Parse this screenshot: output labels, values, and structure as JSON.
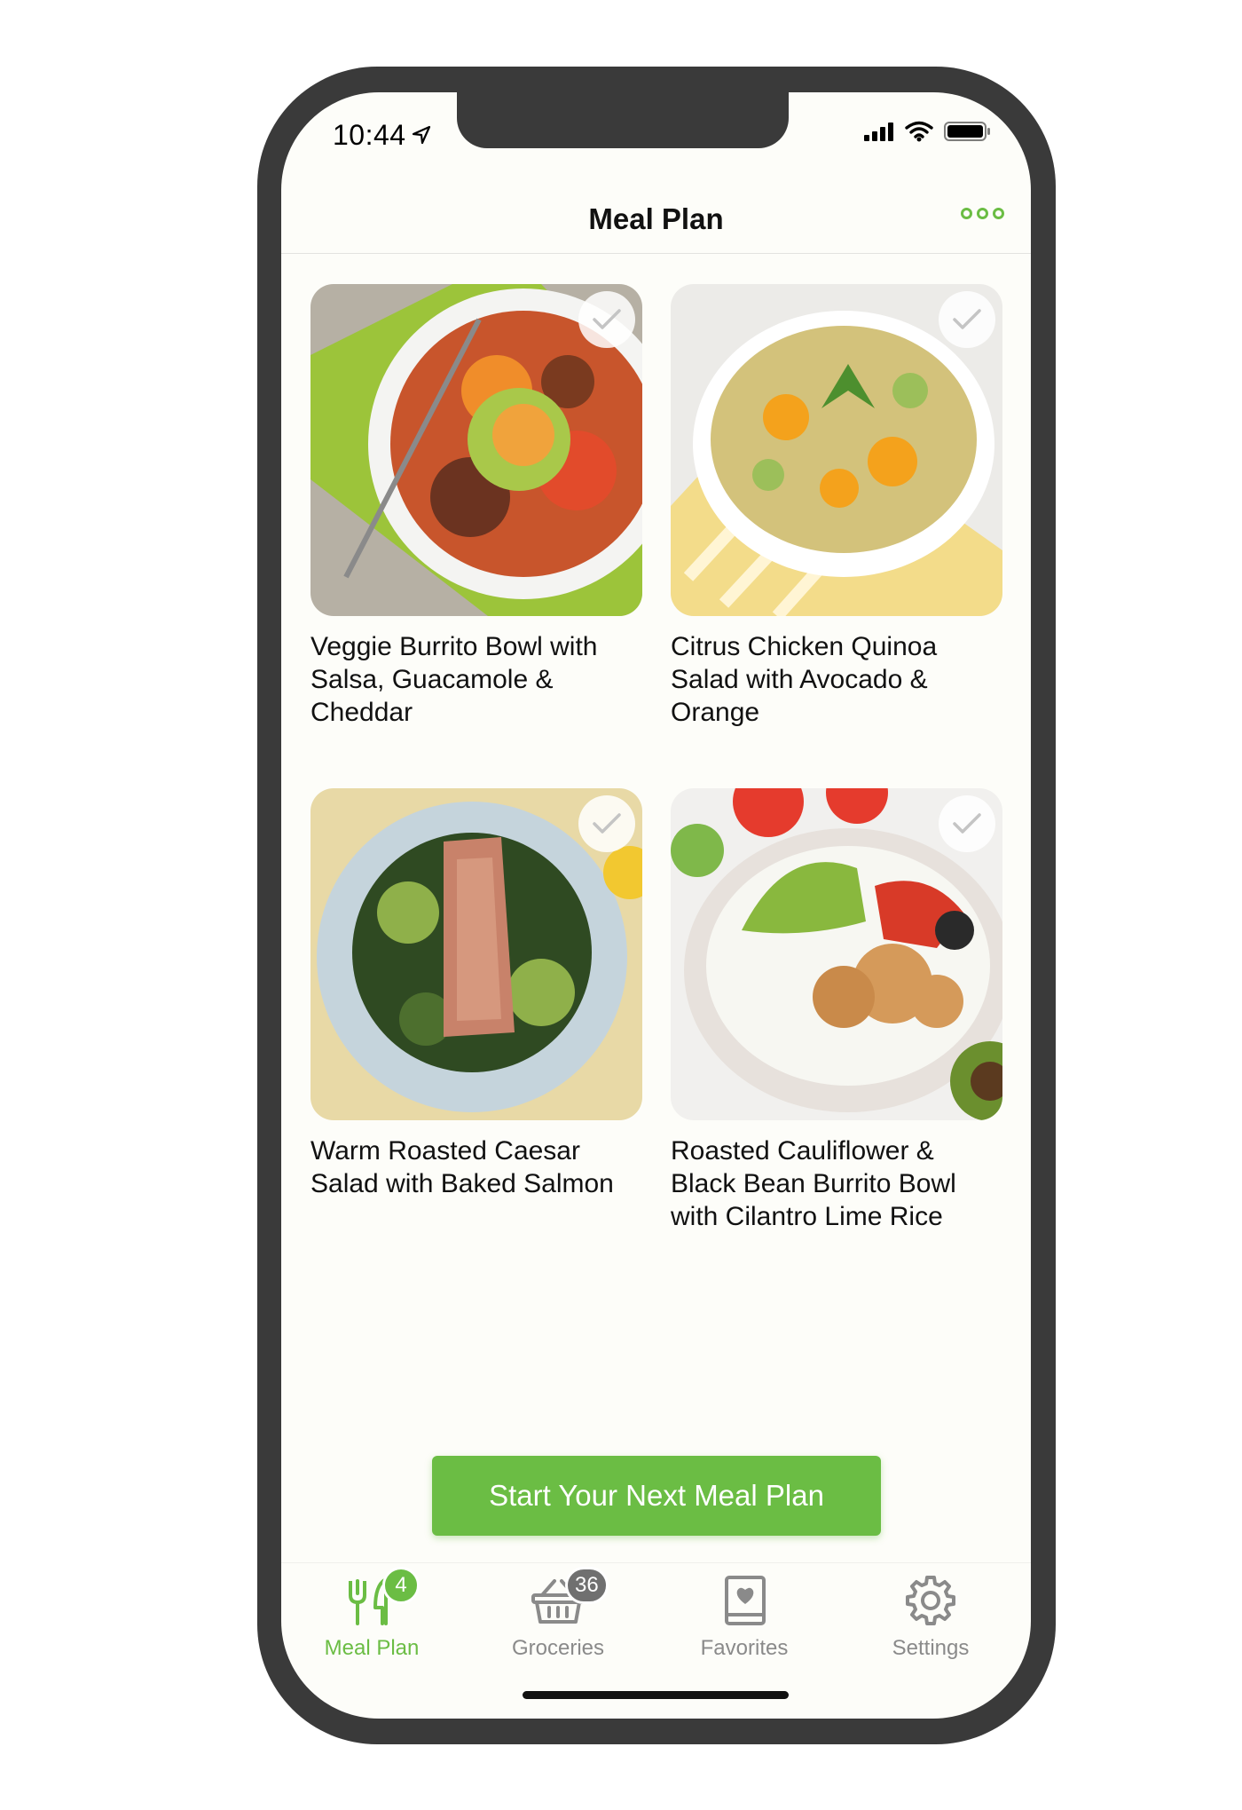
{
  "status_bar": {
    "time": "10:44"
  },
  "header": {
    "title": "Meal Plan"
  },
  "meals": [
    {
      "title_line1": "Veggie Burrito Bowl with",
      "title_line2": "Salsa, Guacamole &",
      "title_line3": "Cheddar"
    },
    {
      "title_line1": "Citrus Chicken Quinoa",
      "title_line2": "Salad with Avocado &",
      "title_line3": "Orange"
    },
    {
      "title_line1": "Warm Roasted Caesar",
      "title_line2": "Salad with Baked Salmon",
      "title_line3": ""
    },
    {
      "title_line1": "Roasted Cauliflower &",
      "title_line2": "Black Bean Burrito Bowl",
      "title_line3": "with Cilantro Lime Rice"
    }
  ],
  "cta": {
    "label": "Start Your Next Meal Plan"
  },
  "tabs": [
    {
      "label": "Meal Plan",
      "badge": "4",
      "icon": "fork-knife-icon",
      "active": true
    },
    {
      "label": "Groceries",
      "badge": "36",
      "icon": "basket-icon",
      "active": false
    },
    {
      "label": "Favorites",
      "badge": "",
      "icon": "heart-book-icon",
      "active": false
    },
    {
      "label": "Settings",
      "badge": "",
      "icon": "gear-icon",
      "active": false
    }
  ],
  "colors": {
    "accent": "#6bbd44",
    "frame": "#3a3a3a",
    "badge_gray": "#707070"
  }
}
